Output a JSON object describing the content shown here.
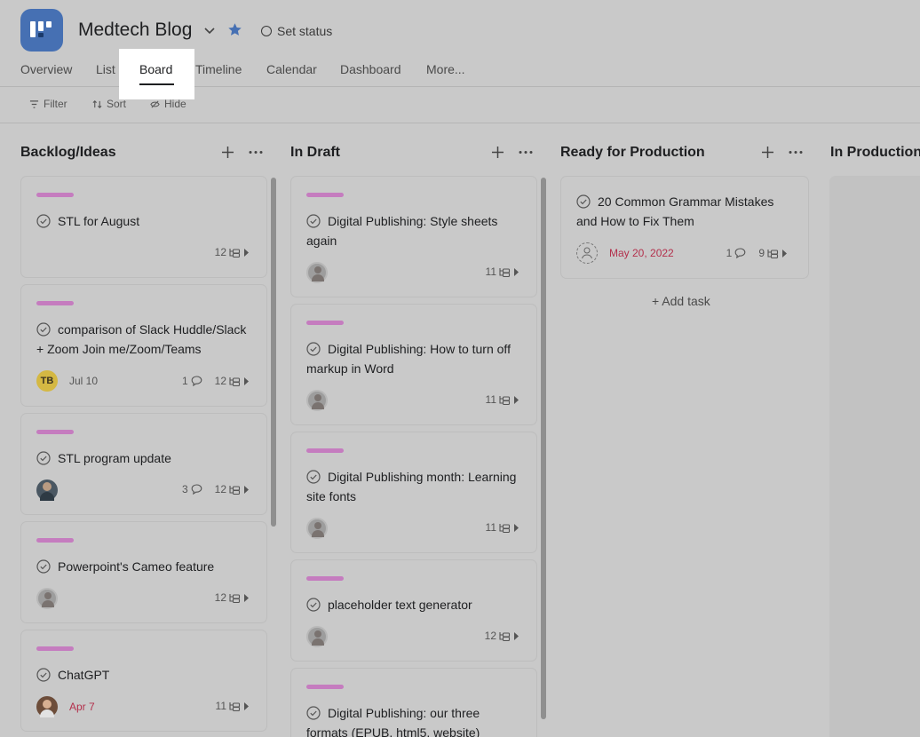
{
  "project": {
    "title": "Medtech Blog",
    "status_label": "Set status",
    "accent": "#4670b3"
  },
  "tabs": [
    "Overview",
    "List",
    "Board",
    "Timeline",
    "Calendar",
    "Dashboard",
    "More..."
  ],
  "active_tab": "Board",
  "toolbar": {
    "filter": "Filter",
    "sort": "Sort",
    "hide": "Hide"
  },
  "columns": [
    {
      "title": "Backlog/Ideas",
      "cards": [
        {
          "title": "STL for August",
          "subtasks": "12"
        },
        {
          "title": "comparison of Slack Huddle/Slack + Zoom Join me/Zoom/Teams",
          "assignee": "TB",
          "date": "Jul 10",
          "comments": "1",
          "subtasks": "12"
        },
        {
          "title": "STL program update",
          "comments": "3",
          "subtasks": "12"
        },
        {
          "title": "Powerpoint's Cameo feature",
          "subtasks": "12"
        },
        {
          "title": "ChatGPT",
          "date": "Apr 7",
          "subtasks": "11"
        }
      ]
    },
    {
      "title": "In Draft",
      "cards": [
        {
          "title": "Digital Publishing: Style sheets again",
          "subtasks": "11"
        },
        {
          "title": "Digital Publishing: How to turn off markup in Word",
          "subtasks": "11"
        },
        {
          "title": "Digital Publishing month: Learning site fonts",
          "subtasks": "11"
        },
        {
          "title": "placeholder text generator",
          "subtasks": "12"
        },
        {
          "title": "Digital Publishing: our three formats (EPUB, html5, website)"
        }
      ]
    },
    {
      "title": "Ready for Production",
      "cards": [
        {
          "title": "20 Common Grammar Mistakes and How to Fix Them",
          "date": "May 20, 2022",
          "comments": "1",
          "subtasks": "9"
        }
      ],
      "add_task": "+ Add task"
    },
    {
      "title": "In Production"
    }
  ],
  "colors": {
    "tag_pink": "#c57cbf",
    "due_red": "#b3304c",
    "star": "#4670b3"
  }
}
